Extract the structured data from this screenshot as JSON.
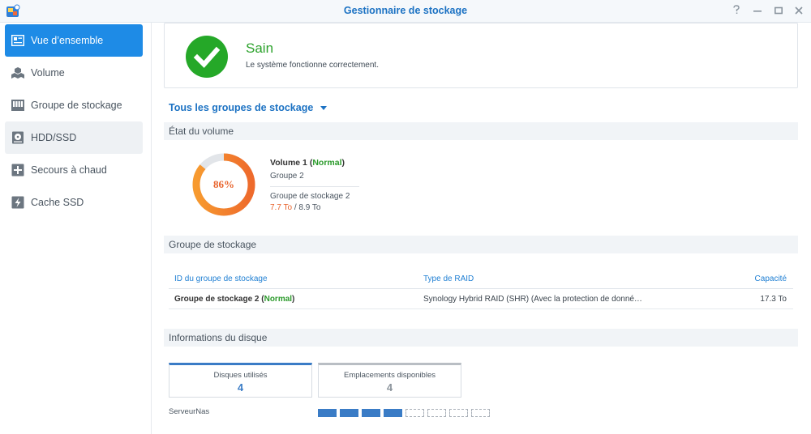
{
  "window": {
    "title": "Gestionnaire de stockage",
    "controls": [
      "help-icon",
      "minimize-icon",
      "maximize-icon",
      "close-icon"
    ]
  },
  "sidebar": {
    "items": [
      {
        "label": "Vue d’ensemble",
        "icon": "overview-icon",
        "active": true
      },
      {
        "label": "Volume",
        "icon": "volume-icon"
      },
      {
        "label": "Groupe de stockage",
        "icon": "storage-pool-icon"
      },
      {
        "label": "HDD/SSD",
        "icon": "hdd-icon"
      },
      {
        "label": "Secours à chaud",
        "icon": "hot-spare-icon"
      },
      {
        "label": "Cache SSD",
        "icon": "ssd-cache-icon"
      }
    ]
  },
  "status": {
    "title": "Sain",
    "description": "Le système fonctionne correctement.",
    "icon": "check-icon",
    "color": "#25a828"
  },
  "pool_selector": {
    "label": "Tous les groupes de stockage"
  },
  "volume_section": {
    "header": "État du volume",
    "usage_percent": 86,
    "usage_label": "86%",
    "name": "Volume 1",
    "status": "Normal",
    "group": "Groupe 2",
    "pool": "Groupe de stockage 2",
    "used": "7.7 To",
    "separator": " / ",
    "total": "8.9 To"
  },
  "pool_section": {
    "header": "Groupe de stockage",
    "columns": [
      "ID du groupe de stockage",
      "Type de RAID",
      "Capacité"
    ],
    "rows": [
      {
        "id": "Groupe de stockage 2",
        "status": "Normal",
        "raid": "Synology Hybrid RAID (SHR) (Avec la protection de donné…",
        "capacity": "17.3 To"
      }
    ]
  },
  "disk_section": {
    "header": "Informations du disque",
    "used_label": "Disques utilisés",
    "used_count": "4",
    "available_label": "Emplacements disponibles",
    "available_count": "4",
    "server_name": "ServeurNas",
    "slots_filled": 4,
    "slots_total": 8
  },
  "colors": {
    "accent": "#1e8be6",
    "healthy": "#25a828",
    "donut_warn": "#e8632c",
    "disk_used": "#3a7cc6"
  }
}
